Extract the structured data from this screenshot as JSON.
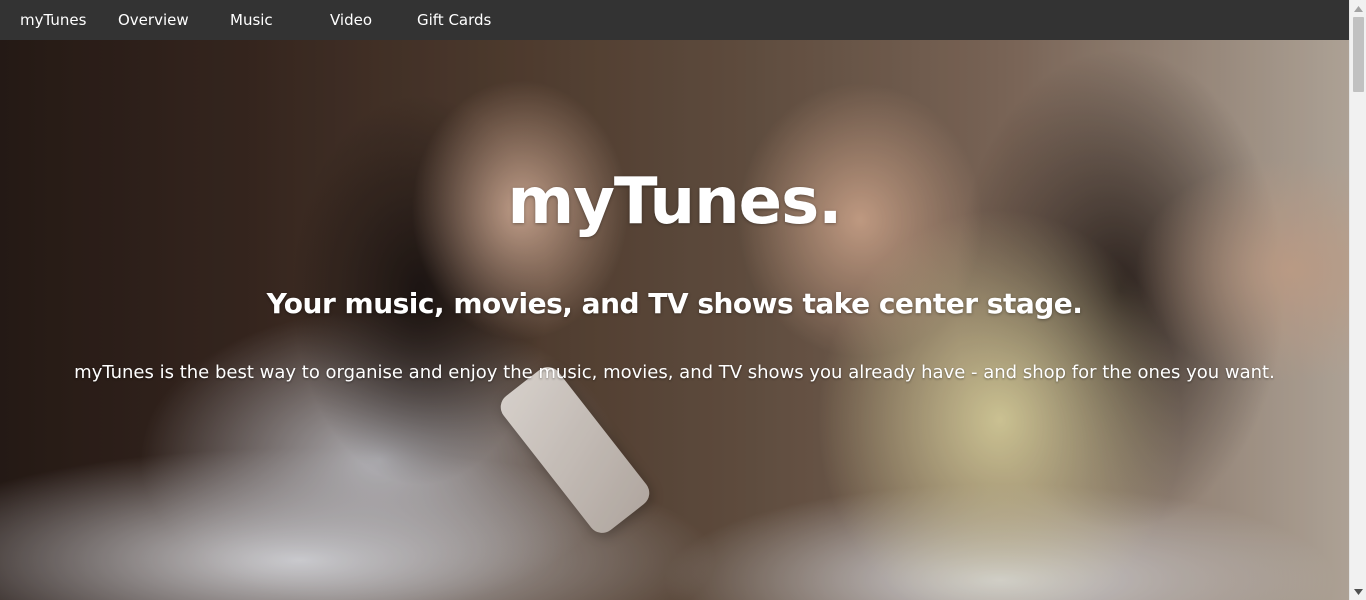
{
  "nav": {
    "brand": "myTunes",
    "items": [
      {
        "label": "Overview"
      },
      {
        "label": "Music"
      },
      {
        "label": "Video"
      },
      {
        "label": "Gift Cards"
      }
    ]
  },
  "hero": {
    "title": "myTunes.",
    "subtitle": "Your music, movies, and TV shows take center stage.",
    "description": "myTunes is the best way to organise and enjoy the music, movies, and TV shows you already have - and shop for the ones you want."
  },
  "colors": {
    "navbar_bg": "#333333",
    "nav_text": "#ffffff",
    "hero_text": "#ffffff"
  },
  "icons": {
    "scroll_up": "scroll-up-arrow-icon",
    "scroll_down": "scroll-down-arrow-icon"
  }
}
